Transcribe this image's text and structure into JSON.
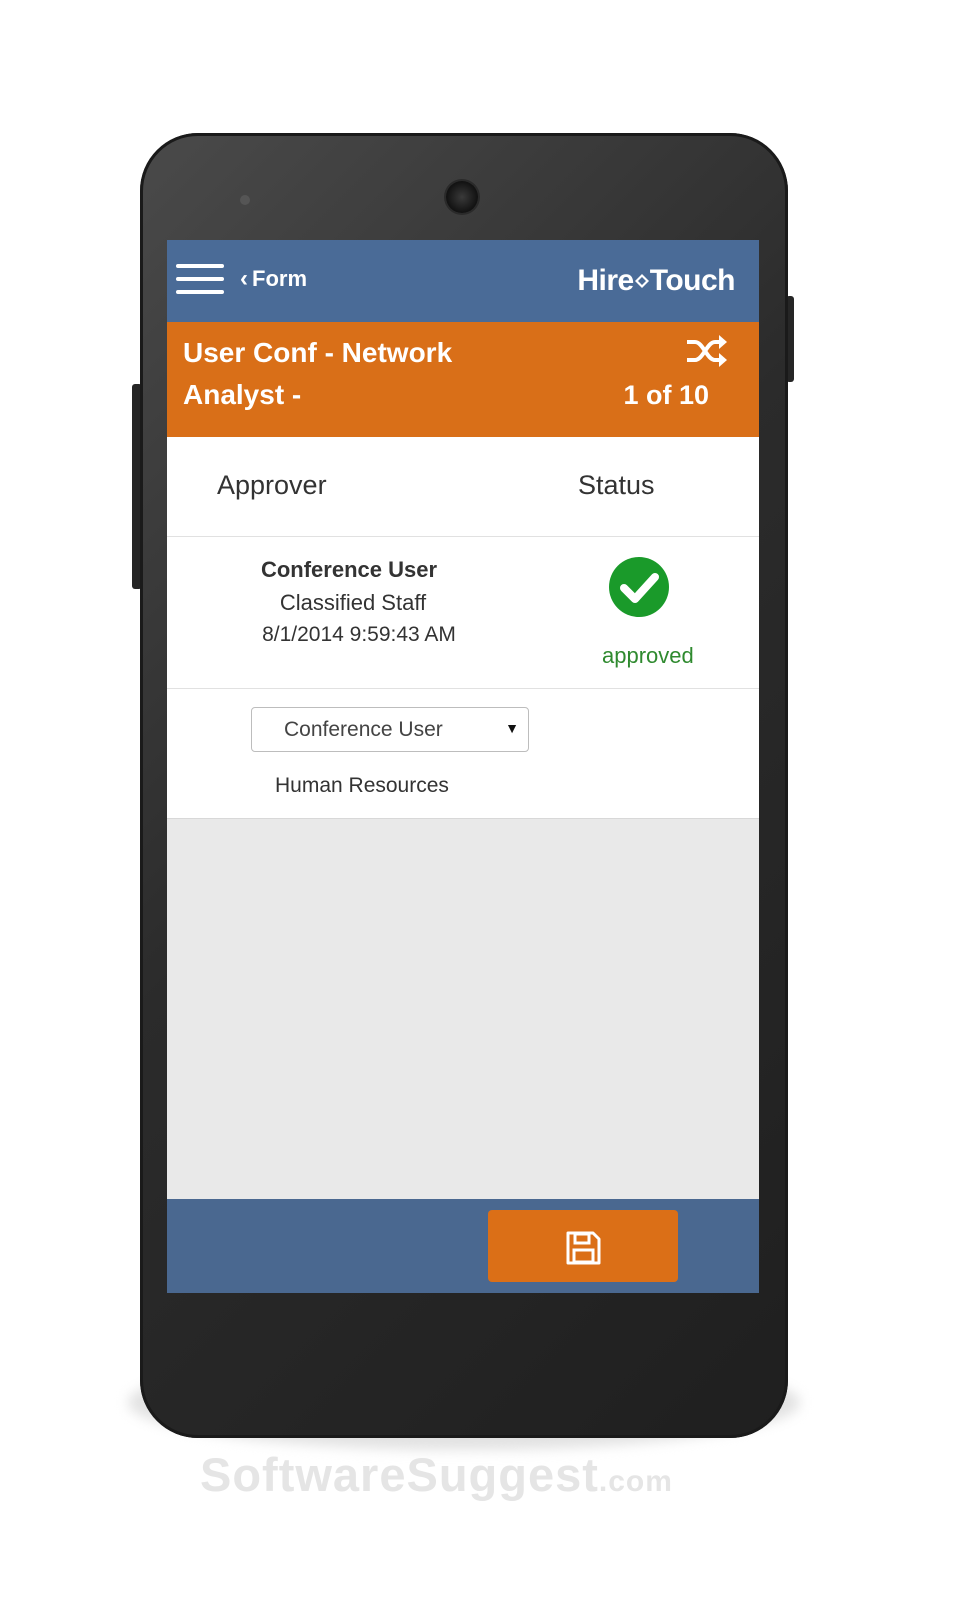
{
  "nav": {
    "back_label": "Form",
    "brand_left": "Hire",
    "brand_right": "Touch"
  },
  "form": {
    "title_line1": "User Conf - Network",
    "title_line2": "Analyst -",
    "position_counter": "1 of 10"
  },
  "approvals_table": {
    "columns": [
      "Approver",
      "Status"
    ],
    "rows": [
      {
        "approver": "Conference User",
        "role": "Classified Staff",
        "timestamp": "8/1/2014 9:59:43 AM",
        "status": "approved"
      },
      {
        "selected_approver": "Conference User",
        "department": "Human Resources"
      }
    ]
  },
  "colors": {
    "nav_blue": "#4a6b97",
    "accent_orange": "#d96f18",
    "approved_green": "#2f8a2f"
  },
  "icons": {
    "menu": "hamburger-icon",
    "back": "chevron-left-icon",
    "shuffle": "shuffle-icon",
    "approved": "check-circle-icon",
    "save": "floppy-disk-icon"
  },
  "watermark": {
    "text": "SoftwareSuggest",
    "suffix": ".com"
  }
}
